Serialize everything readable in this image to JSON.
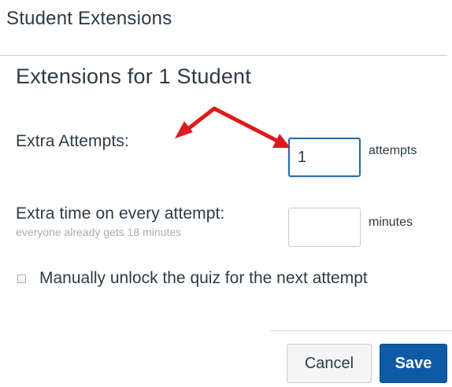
{
  "dialog": {
    "title": "Student Extensions"
  },
  "section": {
    "title": "Extensions for 1 Student"
  },
  "extra_attempts": {
    "label": "Extra Attempts:",
    "value": "1",
    "unit": "attempts"
  },
  "extra_time": {
    "label": "Extra time on every attempt:",
    "hint": "everyone already gets 18 minutes",
    "value": "",
    "unit": "minutes"
  },
  "unlock": {
    "label": "Manually unlock the quiz for the next attempt",
    "checked": false
  },
  "buttons": {
    "cancel": "Cancel",
    "save": "Save"
  },
  "colors": {
    "primary": "#0f5aa6",
    "annotation_arrow": "#e0191b",
    "text": "#2d3b45",
    "hint": "#a5afb5"
  }
}
